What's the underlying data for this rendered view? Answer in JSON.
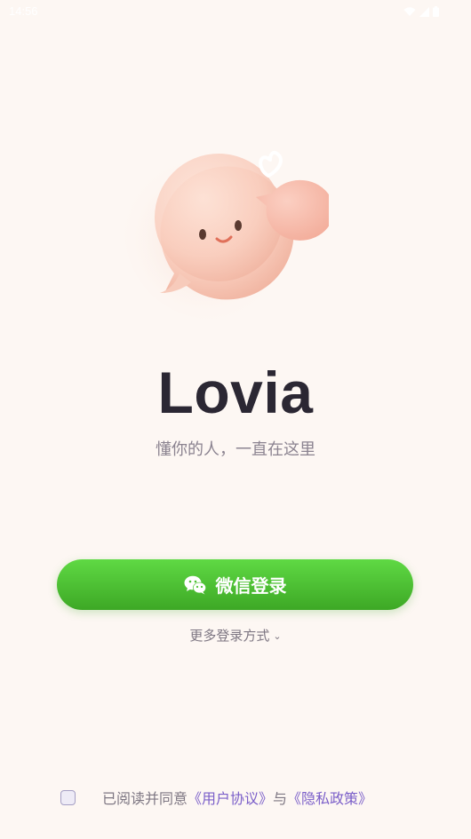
{
  "status_bar": {
    "time": "14:56"
  },
  "brand": {
    "title": "Lovia",
    "tagline": "懂你的人，一直在这里"
  },
  "login": {
    "wechat_label": "微信登录",
    "more_label": "更多登录方式",
    "chevron": "⌄"
  },
  "agreement": {
    "prefix": "已阅读并同意",
    "user_agreement": "《用户协议》",
    "conjunction": "与",
    "privacy_policy": "《隐私政策》",
    "checked": false
  },
  "colors": {
    "background": "#fdf7f3",
    "wechat_green": "#4cc232",
    "link_purple": "#7b5fc9",
    "title": "#2b2733"
  },
  "icons": [
    "wifi-icon",
    "signal-icon",
    "battery-icon",
    "mascot-illustration",
    "heart-bubble-icon",
    "wechat-icon",
    "chevron-down-icon"
  ]
}
